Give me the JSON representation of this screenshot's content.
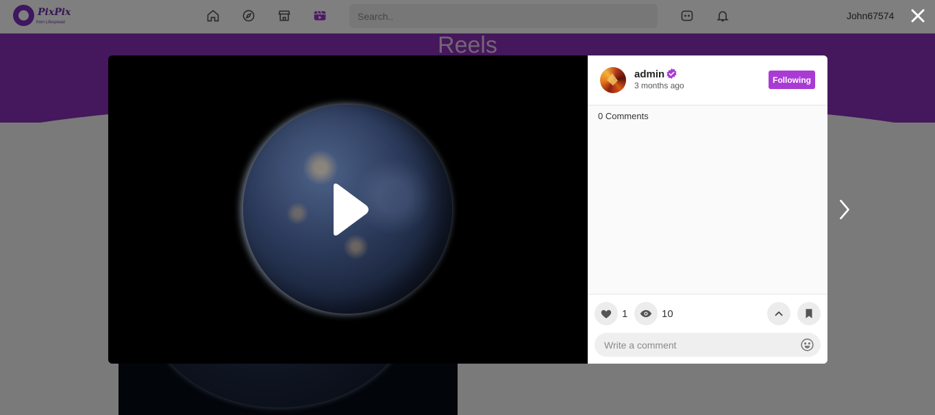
{
  "header": {
    "logo_name": "PixPix",
    "logo_sub": "from Lifespread",
    "nav_icons": [
      "home-icon",
      "explore-compass-icon",
      "store-icon",
      "reels-icon"
    ],
    "search_placeholder": "Search..",
    "messages_icon": "chat-icon",
    "notifications_icon": "bell-icon",
    "username": "John67574",
    "accent_color": "#8b2eb8"
  },
  "page": {
    "title": "Reels"
  },
  "reel_modal": {
    "author": "admin",
    "verified": true,
    "time_ago": "3 months ago",
    "follow_label": "Following",
    "comments_label": "0 Comments",
    "likes": "1",
    "views": "10",
    "comment_placeholder": "Write a comment",
    "button_color": "#a93bd4"
  }
}
